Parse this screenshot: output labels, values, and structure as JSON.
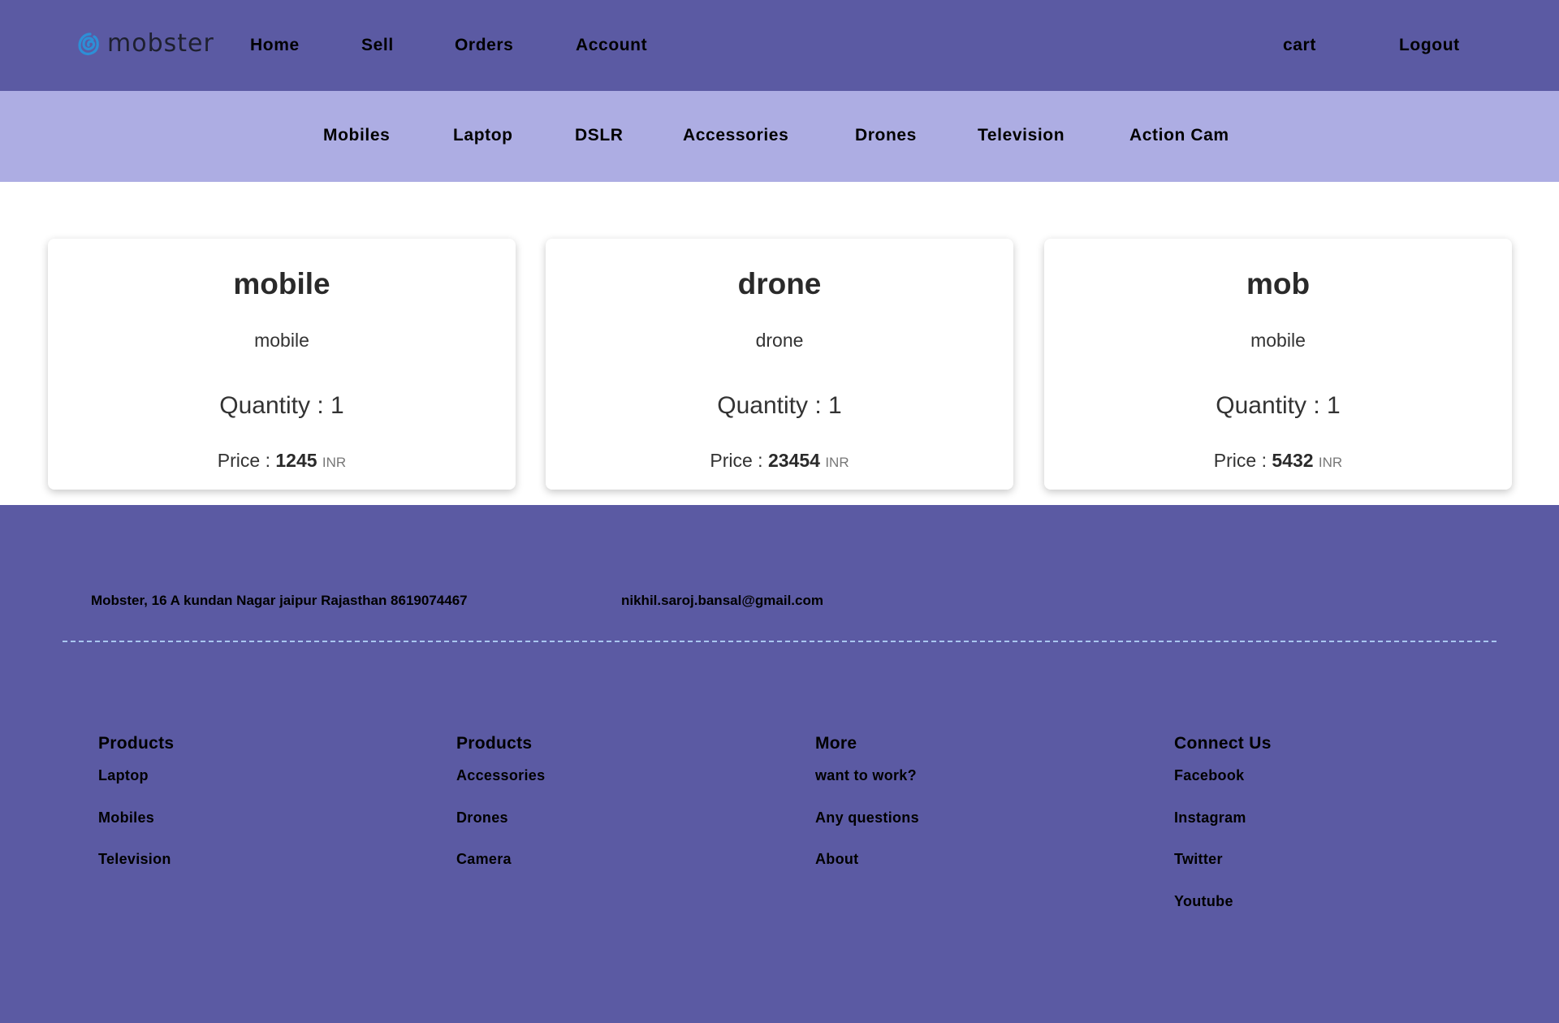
{
  "header": {
    "logo_text": "mobster",
    "nav": [
      "Home",
      "Sell",
      "Orders",
      "Account"
    ],
    "cart_label": "cart",
    "logout_label": "Logout",
    "accent_color": "#5b5aa3"
  },
  "categories": [
    "Mobiles",
    "Laptop",
    "DSLR",
    "Accessories",
    "Drones",
    "Television",
    "Action Cam"
  ],
  "cards": [
    {
      "title": "mobile",
      "category": "mobile",
      "quantity": "Quantity : 1",
      "price_label": "Price :",
      "price": "1245",
      "currency": "INR"
    },
    {
      "title": "drone",
      "category": "drone",
      "quantity": "Quantity : 1",
      "price_label": "Price :",
      "price": "23454",
      "currency": "INR"
    },
    {
      "title": "mob",
      "category": "mobile",
      "quantity": "Quantity : 1",
      "price_label": "Price :",
      "price": "5432",
      "currency": "INR"
    }
  ],
  "footer": {
    "address": "Mobster, 16 A kundan Nagar jaipur Rajasthan  8619074467",
    "email": "nikhil.saroj.bansal@gmail.com",
    "columns": [
      {
        "title": "Products",
        "links": [
          "Laptop",
          "Mobiles",
          "Television"
        ]
      },
      {
        "title": "Products",
        "links": [
          "Accessories",
          "Drones",
          "Camera"
        ]
      },
      {
        "title": "More",
        "links": [
          "want to work?",
          "Any questions",
          "About"
        ]
      },
      {
        "title": "Connect Us",
        "links": [
          "Facebook",
          "Instagram",
          "Twitter",
          "Youtube"
        ]
      }
    ]
  }
}
